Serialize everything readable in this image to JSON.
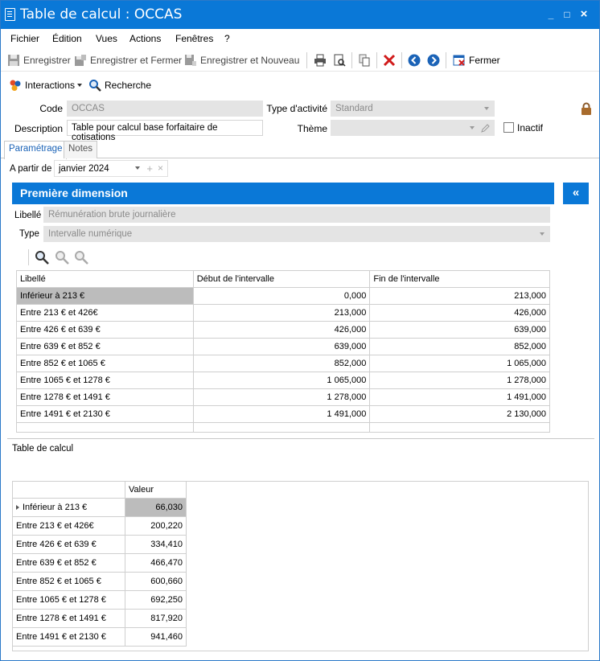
{
  "window": {
    "title": "Table de calcul : OCCAS",
    "minimize": "_",
    "maximize": "□",
    "close": "×"
  },
  "menu": [
    "Fichier",
    "Édition",
    "Vues",
    "Actions",
    "Fenêtres",
    "?"
  ],
  "toolbar": {
    "save": "Enregistrer",
    "save_close": "Enregistrer et Fermer",
    "save_new": "Enregistrer et Nouveau",
    "close": "Fermer"
  },
  "toolbar2": {
    "interactions": "Interactions",
    "search": "Recherche"
  },
  "form": {
    "code_label": "Code",
    "code_value": "OCCAS",
    "activity_label": "Type d'activité",
    "activity_value": "Standard",
    "description_label": "Description",
    "description_value": "Table pour calcul base forfaitaire de cotisations",
    "theme_label": "Thème",
    "theme_value": "",
    "inactive_label": "Inactif"
  },
  "tabs": [
    "Paramétrage",
    "Notes"
  ],
  "from_label": "A partir de",
  "from_value": "janvier 2024",
  "dimension": {
    "title": "Première dimension",
    "collapse": "«",
    "libelle_label": "Libellé",
    "libelle_value": "Rémunération brute journalière",
    "type_label": "Type",
    "type_value": "Intervalle numérique"
  },
  "intervals": {
    "headers": [
      "Libellé",
      "Début de l'intervalle",
      "Fin de l'intervalle"
    ],
    "rows": [
      [
        "Inférieur à 213 €",
        "0,000",
        "213,000"
      ],
      [
        "Entre 213 € et 426€",
        "213,000",
        "426,000"
      ],
      [
        "Entre 426 € et 639 €",
        "426,000",
        "639,000"
      ],
      [
        "Entre 639 € et 852 €",
        "639,000",
        "852,000"
      ],
      [
        "Entre 852 € et 1065 €",
        "852,000",
        "1 065,000"
      ],
      [
        "Entre 1065 € et 1278 €",
        "1 065,000",
        "1 278,000"
      ],
      [
        "Entre 1278 € et 1491 €",
        "1 278,000",
        "1 491,000"
      ],
      [
        "Entre 1491 € et 2130 €",
        "1 491,000",
        "2 130,000"
      ]
    ]
  },
  "calc_table": {
    "title": "Table de calcul",
    "value_header": "Valeur",
    "rows": [
      [
        "Inférieur à 213 €",
        "66,030"
      ],
      [
        "Entre 213 € et 426€",
        "200,220"
      ],
      [
        "Entre 426 € et 639 €",
        "334,410"
      ],
      [
        "Entre 639 € et 852 €",
        "466,470"
      ],
      [
        "Entre 852 € et 1065 €",
        "600,660"
      ],
      [
        "Entre 1065 € et 1278 €",
        "692,250"
      ],
      [
        "Entre 1278 € et 1491 €",
        "817,920"
      ],
      [
        "Entre 1491 € et 2130 €",
        "941,460"
      ]
    ]
  },
  "colors": {
    "accent": "#0a78d7",
    "selected": "#bcbcbc"
  }
}
